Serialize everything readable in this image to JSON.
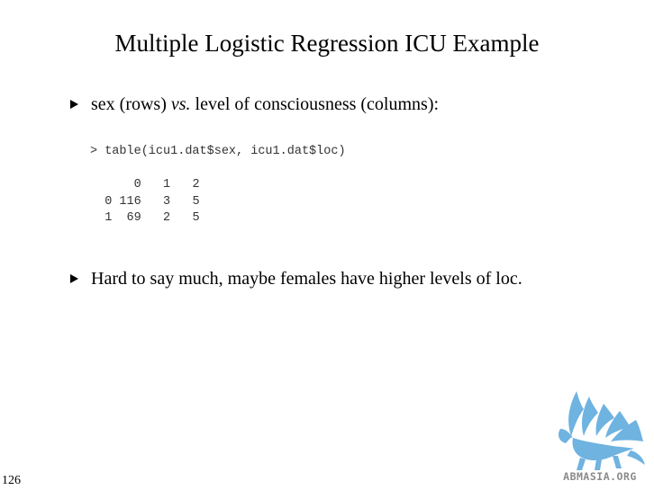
{
  "slide": {
    "title": "Multiple Logistic Regression ICU Example",
    "page_number": "126"
  },
  "bullets": [
    {
      "text_before": "sex (rows) ",
      "emphasis": "vs.",
      "text_after": " level of consciousness (columns):"
    },
    {
      "text": "Hard to say much, maybe females have higher levels of loc."
    }
  ],
  "code": {
    "command": "> table(icu1.dat$sex, icu1.dat$loc)",
    "table": {
      "column_headers": [
        "0",
        "1",
        "2"
      ],
      "rows": [
        {
          "label": "0",
          "values": [
            "116",
            "3",
            "5"
          ]
        },
        {
          "label": "1",
          "values": [
            "69",
            "2",
            "5"
          ]
        }
      ]
    }
  },
  "logo": {
    "text": "ABMASIA.ORG",
    "icon": "griffin-logo-icon",
    "color": "#6fb3e0"
  }
}
